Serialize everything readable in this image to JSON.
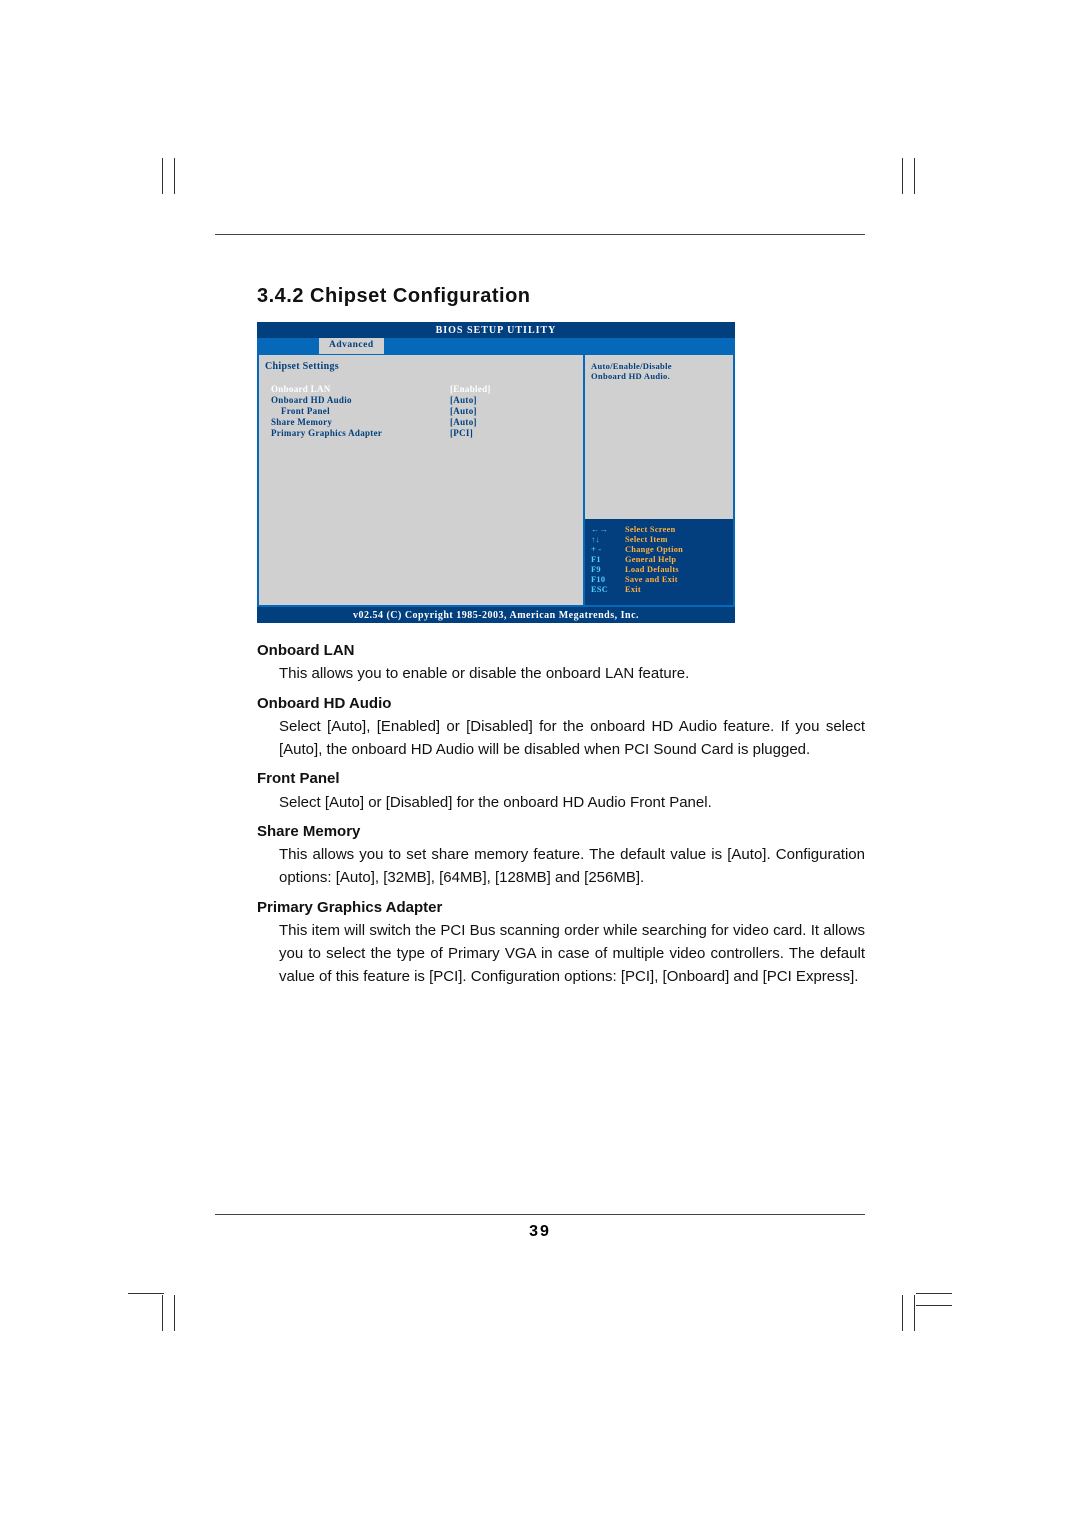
{
  "section_number_title": "3.4.2  Chipset Configuration",
  "bios": {
    "header": "BIOS SETUP UTILITY",
    "active_tab": "Advanced",
    "panel_title": "Chipset Settings",
    "settings": [
      {
        "label": "Onboard LAN",
        "value": "[Enabled]",
        "selected": true
      },
      {
        "label": "Onboard HD Audio",
        "value": "[Auto]",
        "selected": false
      },
      {
        "label": "Front Panel",
        "value": "[Auto]",
        "selected": false
      },
      {
        "label": "Share Memory",
        "value": "[Auto]",
        "selected": false
      },
      {
        "label": "Primary Graphics Adapter",
        "value": "[PCI]",
        "selected": false
      }
    ],
    "help_top_line1": "Auto/Enable/Disable",
    "help_top_line2": "Onboard HD Audio.",
    "nav": [
      {
        "key": "←→",
        "text": "Select Screen"
      },
      {
        "key": "↑↓",
        "text": "Select Item"
      },
      {
        "key": "+ -",
        "text": "Change Option"
      },
      {
        "key": "F1",
        "text": "General Help"
      },
      {
        "key": "F9",
        "text": "Load Defaults"
      },
      {
        "key": "F10",
        "text": "Save and Exit"
      },
      {
        "key": "ESC",
        "text": "Exit"
      }
    ],
    "footer": "v02.54 (C) Copyright 1985-2003, American Megatrends, Inc."
  },
  "descriptions": [
    {
      "title": "Onboard LAN",
      "body": "This allows you to enable or disable the onboard LAN feature."
    },
    {
      "title": "Onboard HD Audio",
      "body": "Select [Auto], [Enabled] or [Disabled] for the onboard HD Audio feature. If you select [Auto], the onboard HD Audio will be disabled when PCI Sound Card is plugged."
    },
    {
      "title": "Front Panel",
      "body": "Select [Auto] or [Disabled] for the onboard HD Audio Front Panel."
    },
    {
      "title": "Share Memory",
      "body": "This allows you to set share memory feature. The default value is [Auto]. Configuration options: [Auto], [32MB], [64MB], [128MB] and [256MB]."
    },
    {
      "title": "Primary Graphics Adapter",
      "body": "This item will switch the PCI Bus scanning order while searching for video card. It allows you to select the type of Primary VGA in case of multiple video controllers. The default value of this feature is [PCI]. Configuration options: [PCI], [Onboard] and [PCI Express]."
    }
  ],
  "page_number": "39"
}
